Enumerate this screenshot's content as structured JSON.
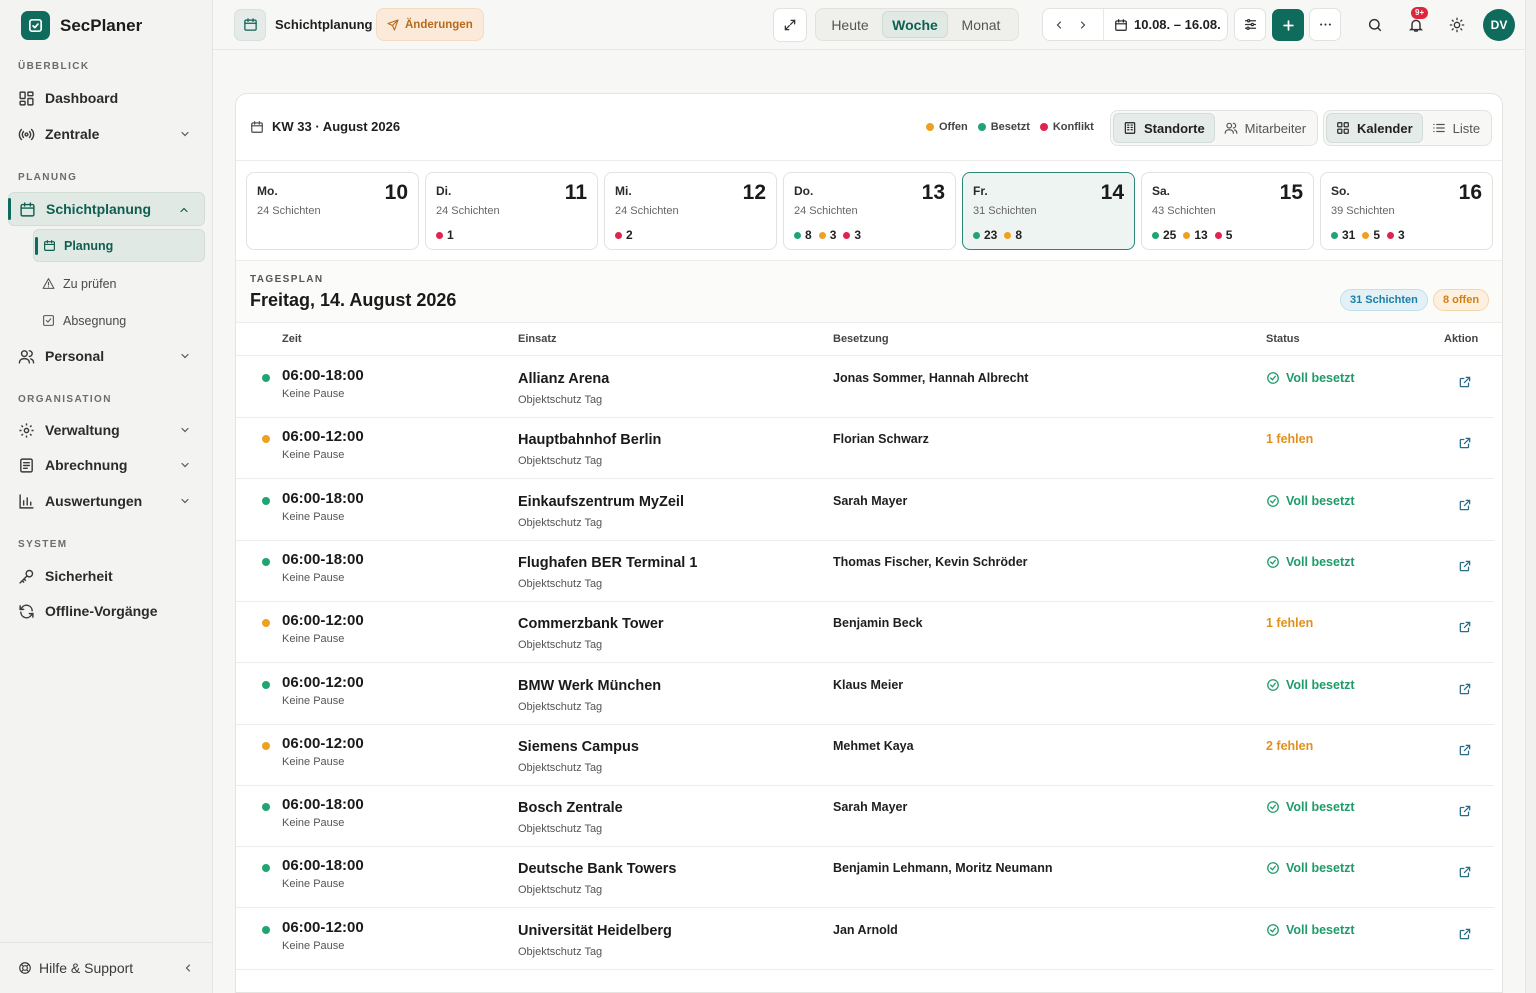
{
  "app": {
    "name": "SecPlaner"
  },
  "sidebar": {
    "sections": {
      "overview": "ÜBERBLICK",
      "planning": "PLANUNG",
      "organisation": "ORGANISATION",
      "system": "SYSTEM"
    },
    "items": {
      "dashboard": "Dashboard",
      "zentrale": "Zentrale",
      "schichtplanung": "Schichtplanung",
      "planung": "Planung",
      "zu_pruefen": "Zu prüfen",
      "absegnung": "Absegnung",
      "personal": "Personal",
      "verwaltung": "Verwaltung",
      "abrechnung": "Abrechnung",
      "auswertungen": "Auswertungen",
      "sicherheit": "Sicherheit",
      "offline": "Offline-Vorgänge"
    },
    "help": "Hilfe & Support"
  },
  "topbar": {
    "breadcrumb": "Schichtplanung",
    "changes": "Änderungen",
    "views": [
      "Heute",
      "Woche",
      "Monat"
    ],
    "active_view": "Woche",
    "range": "10.08. – 16.08.",
    "notif_badge": "9+",
    "avatar": "DV"
  },
  "calendar": {
    "kw_title": "KW 33 · August 2026",
    "legend": {
      "open": "Offen",
      "filled": "Besetzt",
      "conflict": "Konflikt"
    },
    "group_toggle": {
      "a": "Standorte",
      "b": "Mitarbeiter",
      "active": "Standorte"
    },
    "view_toggle": {
      "a": "Kalender",
      "b": "Liste",
      "active": "Kalender"
    },
    "colors": {
      "open": "#f0a020",
      "filled": "#1fa572",
      "conflict": "#e0244d",
      "accent": "#0f6b5b"
    },
    "days": [
      {
        "label": "Mo.",
        "num": "10",
        "count": "24 Schichten",
        "chips": []
      },
      {
        "label": "Di.",
        "num": "11",
        "count": "24 Schichten",
        "chips": [
          {
            "kind": "conflict",
            "value": "1"
          }
        ]
      },
      {
        "label": "Mi.",
        "num": "12",
        "count": "24 Schichten",
        "chips": [
          {
            "kind": "conflict",
            "value": "2"
          }
        ]
      },
      {
        "label": "Do.",
        "num": "13",
        "count": "24 Schichten",
        "chips": [
          {
            "kind": "filled",
            "value": "8"
          },
          {
            "kind": "open",
            "value": "3"
          },
          {
            "kind": "conflict",
            "value": "3"
          }
        ]
      },
      {
        "label": "Fr.",
        "num": "14",
        "count": "31 Schichten",
        "chips": [
          {
            "kind": "filled",
            "value": "23"
          },
          {
            "kind": "open",
            "value": "8"
          }
        ],
        "selected": true
      },
      {
        "label": "Sa.",
        "num": "15",
        "count": "43 Schichten",
        "chips": [
          {
            "kind": "filled",
            "value": "25"
          },
          {
            "kind": "open",
            "value": "13"
          },
          {
            "kind": "conflict",
            "value": "5"
          }
        ]
      },
      {
        "label": "So.",
        "num": "16",
        "count": "39 Schichten",
        "chips": [
          {
            "kind": "filled",
            "value": "31"
          },
          {
            "kind": "open",
            "value": "5"
          },
          {
            "kind": "conflict",
            "value": "3"
          }
        ]
      }
    ]
  },
  "dayplan": {
    "label": "TAGESPLAN",
    "title": "Freitag, 14. August 2026",
    "shifts_pill": "31 Schichten",
    "open_pill": "8 offen",
    "columns": {
      "time": "Zeit",
      "site": "Einsatz",
      "staff": "Besetzung",
      "status": "Status",
      "action": "Aktion"
    },
    "rows": [
      {
        "state": "filled",
        "time": "06:00-18:00",
        "pause": "Keine Pause",
        "site": "Allianz Arena",
        "type": "Objektschutz Tag",
        "staff": "Jonas Sommer, Hannah Albrecht",
        "status": "Voll besetzt"
      },
      {
        "state": "open",
        "time": "06:00-12:00",
        "pause": "Keine Pause",
        "site": "Hauptbahnhof Berlin",
        "type": "Objektschutz Tag",
        "staff": "Florian Schwarz",
        "status": "1 fehlen"
      },
      {
        "state": "filled",
        "time": "06:00-18:00",
        "pause": "Keine Pause",
        "site": "Einkaufszentrum MyZeil",
        "type": "Objektschutz Tag",
        "staff": "Sarah Mayer",
        "status": "Voll besetzt"
      },
      {
        "state": "filled",
        "time": "06:00-18:00",
        "pause": "Keine Pause",
        "site": "Flughafen BER Terminal 1",
        "type": "Objektschutz Tag",
        "staff": "Thomas Fischer, Kevin Schröder",
        "status": "Voll besetzt"
      },
      {
        "state": "open",
        "time": "06:00-12:00",
        "pause": "Keine Pause",
        "site": "Commerzbank Tower",
        "type": "Objektschutz Tag",
        "staff": "Benjamin Beck",
        "status": "1 fehlen"
      },
      {
        "state": "filled",
        "time": "06:00-12:00",
        "pause": "Keine Pause",
        "site": "BMW Werk München",
        "type": "Objektschutz Tag",
        "staff": "Klaus Meier",
        "status": "Voll besetzt"
      },
      {
        "state": "open",
        "time": "06:00-12:00",
        "pause": "Keine Pause",
        "site": "Siemens Campus",
        "type": "Objektschutz Tag",
        "staff": "Mehmet Kaya",
        "status": "2 fehlen"
      },
      {
        "state": "filled",
        "time": "06:00-18:00",
        "pause": "Keine Pause",
        "site": "Bosch Zentrale",
        "type": "Objektschutz Tag",
        "staff": "Sarah Mayer",
        "status": "Voll besetzt"
      },
      {
        "state": "filled",
        "time": "06:00-18:00",
        "pause": "Keine Pause",
        "site": "Deutsche Bank Towers",
        "type": "Objektschutz Tag",
        "staff": "Benjamin Lehmann, Moritz Neumann",
        "status": "Voll besetzt"
      },
      {
        "state": "filled",
        "time": "06:00-12:00",
        "pause": "Keine Pause",
        "site": "Universität Heidelberg",
        "type": "Objektschutz Tag",
        "staff": "Jan Arnold",
        "status": "Voll besetzt"
      }
    ]
  }
}
